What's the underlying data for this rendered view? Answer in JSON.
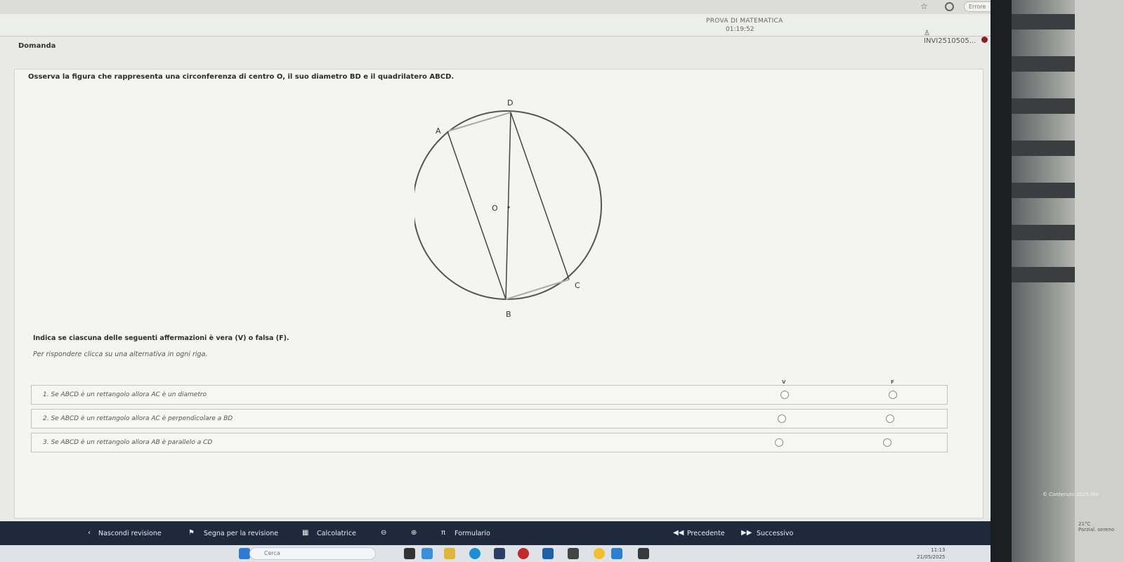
{
  "browser": {
    "error_label": "Errore",
    "error_menu": "⋮"
  },
  "header": {
    "exam_title": "PROVA DI MATEMATICA",
    "timer": "01:19:52",
    "user": "INVI2510505..."
  },
  "question": {
    "section_label": "Domanda",
    "text": "Osserva la figura che rappresenta una circonferenza di centro O, il suo diametro BD e il quadrilatero ABCD.",
    "figure_labels": {
      "a": "A",
      "b": "B",
      "c": "C",
      "d": "D",
      "o": "O"
    },
    "instruction": "Indica se ciascuna delle seguenti affermazioni è vera (V) o falsa (F).",
    "hint": "Per rispondere clicca su una alternativa in ogni riga.",
    "column_true": "V",
    "column_false": "F",
    "statements": [
      {
        "label": "1. Se ABCD è un rettangolo allora AC è un diametro"
      },
      {
        "label": "2. Se ABCD è un rettangolo allora AC è perpendicolare a BD"
      },
      {
        "label": "3. Se ABCD è un rettangolo allora AB è parallelo a CD"
      }
    ]
  },
  "credits": "© Contenuto 2025 INV",
  "toolbar": {
    "hide_review": "Nascondi revisione",
    "mark_review": "Segna per la revisione",
    "calculator": "Calcolatrice",
    "formulas": "Formulario",
    "previous": "Precedente",
    "next": "Successivo"
  },
  "taskbar": {
    "search_placeholder": "Cerca",
    "time": "11:13",
    "date": "21/05/2025",
    "weather_temp": "21°C",
    "weather_desc": "Parzial. sereno"
  },
  "colors": {
    "toolbar_bg": "#1e2a3c",
    "page_bg": "#e9eae6"
  }
}
